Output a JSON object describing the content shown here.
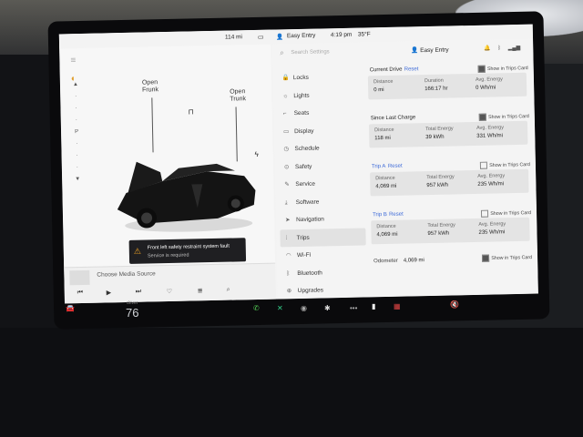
{
  "status": {
    "range": "114 mi",
    "profile": "Easy Entry",
    "time": "4:19 pm",
    "temp": "35°F"
  },
  "car": {
    "frunk_label_1": "Open",
    "frunk_label_2": "Frunk",
    "trunk_label_1": "Open",
    "trunk_label_2": "Trunk",
    "alert_title": "Front left safety restraint system fault",
    "alert_sub": "Service is required"
  },
  "media": {
    "source_label": "Choose Media Source"
  },
  "settings": {
    "search_placeholder": "Search Settings",
    "profile": "Easy Entry",
    "menu": [
      "Locks",
      "Lights",
      "Seats",
      "Display",
      "Schedule",
      "Safety",
      "Service",
      "Software",
      "Navigation",
      "Trips",
      "Wi-Fi",
      "Bluetooth",
      "Upgrades"
    ],
    "active_item": "Trips",
    "reset_label": "Reset",
    "show_label": "Show in Trips Card",
    "current_drive": {
      "title": "Current Drive",
      "show_checked": true,
      "stats": [
        {
          "k": "Distance",
          "v": "0 mi"
        },
        {
          "k": "Duration",
          "v": "166:17 hr"
        },
        {
          "k": "Avg. Energy",
          "v": "0 Wh/mi"
        }
      ]
    },
    "since_charge": {
      "title": "Since Last Charge",
      "show_checked": true,
      "stats": [
        {
          "k": "Distance",
          "v": "118 mi"
        },
        {
          "k": "Total Energy",
          "v": "39 kWh"
        },
        {
          "k": "Avg. Energy",
          "v": "331 Wh/mi"
        }
      ]
    },
    "trip_a": {
      "title": "Trip A",
      "show_checked": false,
      "stats": [
        {
          "k": "Distance",
          "v": "4,069 mi"
        },
        {
          "k": "Total Energy",
          "v": "957 kWh"
        },
        {
          "k": "Avg. Energy",
          "v": "235 Wh/mi"
        }
      ]
    },
    "trip_b": {
      "title": "Trip B",
      "show_checked": false,
      "stats": [
        {
          "k": "Distance",
          "v": "4,069 mi"
        },
        {
          "k": "Total Energy",
          "v": "957 kWh"
        },
        {
          "k": "Avg. Energy",
          "v": "235 Wh/mi"
        }
      ]
    },
    "odometer_label": "Odometer",
    "odometer_value": "4,069 mi",
    "odometer_show_checked": true
  },
  "taskbar": {
    "speed": "76",
    "speed_unit": "driver"
  }
}
